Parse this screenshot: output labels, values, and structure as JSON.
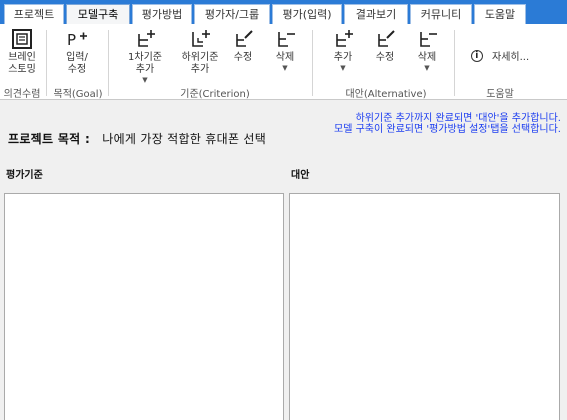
{
  "tabs": [
    {
      "label": "프로젝트"
    },
    {
      "label": "모델구축"
    },
    {
      "label": "평가방법"
    },
    {
      "label": "평가자/그룹"
    },
    {
      "label": "평가(입력)"
    },
    {
      "label": "결과보기"
    },
    {
      "label": "커뮤니티"
    },
    {
      "label": "도움말"
    }
  ],
  "ribbon": {
    "brainstorm": {
      "line1": "브레인",
      "line2": "스토밍"
    },
    "goal_input": {
      "line1": "입력/",
      "line2": "수정"
    },
    "crit_add": {
      "line1": "1차기준",
      "line2": "추가"
    },
    "crit_sub": {
      "line1": "하위기준",
      "line2": "추가"
    },
    "crit_edit": {
      "label": "수정"
    },
    "crit_delete": {
      "label": "삭제"
    },
    "alt_add": {
      "label": "추가"
    },
    "alt_edit": {
      "label": "수정"
    },
    "alt_delete": {
      "label": "삭제"
    },
    "details": {
      "label": "자세히..."
    },
    "groups": {
      "opinion": "의견수렴",
      "goal": "목적(Goal)",
      "criterion": "기준(Criterion)",
      "alternative": "대안(Alternative)",
      "help": "도움말"
    }
  },
  "hint": {
    "line1": "하위기준 추가까지 완료되면 '대안'을 추가합니다.",
    "line2": "모델 구축이 완료되면 '평가방법 설정'탭을 선택합니다."
  },
  "goal": {
    "label": "프로젝트 목적 :",
    "value": "나에게 가장 적합한 휴대폰 선택"
  },
  "panels": {
    "criteria_title": "평가기준",
    "alternatives_title": "대안"
  },
  "colors": {
    "tabbar": "#2b7bd6",
    "hint_text": "#1a3cf0"
  }
}
